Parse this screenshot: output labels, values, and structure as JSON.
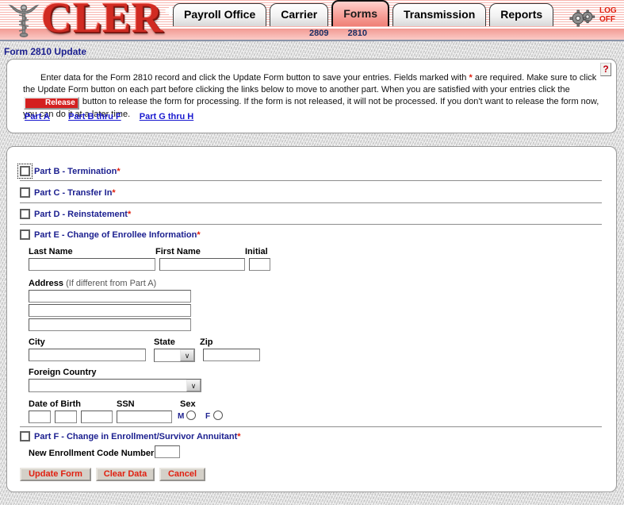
{
  "brand": {
    "name": "CLER",
    "logo_icon": "caduceus-icon"
  },
  "topnav": {
    "tabs": [
      {
        "label": "Payroll Office",
        "active": false
      },
      {
        "label": "Carrier",
        "active": false
      },
      {
        "label": "Forms",
        "active": true
      },
      {
        "label": "Transmission",
        "active": false
      },
      {
        "label": "Reports",
        "active": false
      }
    ],
    "subtabs": [
      {
        "label": "2809"
      },
      {
        "label": "2810"
      }
    ],
    "gears_icon": "gears-icon",
    "logoff_line1": "LOG",
    "logoff_line2": "OFF"
  },
  "page": {
    "title": "Form 2810 Update",
    "help_icon": "?"
  },
  "instructions": {
    "line1_a": "Enter data for the Form 2810 record and click the Update Form button to save your entries.  Fields marked with ",
    "asterisk": "*",
    "line1_b": " are required.  Make sure to click the Update Form button on each part before clicking the links below to move to another part.  When you are satisfied with your entries click the ",
    "release_label": "Release",
    "line1_c": " button to release the form for processing.  If the form is not released, it will not be processed.  If you don't want to release the form now, you can do it at a later time."
  },
  "part_links": [
    {
      "label": "Part A"
    },
    {
      "label": "Part B thru F"
    },
    {
      "label": "Part G thru H"
    }
  ],
  "parts": [
    {
      "id": "part-b",
      "label": "Part B - Termination",
      "required": "*",
      "checked": false,
      "focused": true
    },
    {
      "id": "part-c",
      "label": "Part C - Transfer In",
      "required": "*",
      "checked": false,
      "focused": false
    },
    {
      "id": "part-d",
      "label": "Part D - Reinstatement",
      "required": "*",
      "checked": false,
      "focused": false
    },
    {
      "id": "part-e",
      "label": "Part E - Change of Enrollee Information",
      "required": "*",
      "checked": false,
      "focused": false
    },
    {
      "id": "part-f",
      "label": "Part F - Change in Enrollment/Survivor Annuitant",
      "required": "*",
      "checked": false,
      "focused": false
    }
  ],
  "part_e": {
    "last_name_label": "Last Name",
    "last_name_value": "",
    "first_name_label": "First Name",
    "first_name_value": "",
    "initial_label": "Initial",
    "initial_value": "",
    "address_label": "Address",
    "address_note": "(If different from Part A)",
    "address_line1": "",
    "address_line2": "",
    "address_line3": "",
    "city_label": "City",
    "city_value": "",
    "state_label": "State",
    "state_value": "",
    "zip_label": "Zip",
    "zip_value": "",
    "foreign_country_label": "Foreign Country",
    "foreign_country_value": "",
    "dob_label": "Date of Birth",
    "dob_month": "",
    "dob_day": "",
    "dob_year": "",
    "ssn_label": "SSN",
    "ssn_value": "",
    "sex_label": "Sex",
    "sex_m_label": "M",
    "sex_f_label": "F",
    "sex_selected": ""
  },
  "part_f": {
    "code_label": "New Enrollment Code Number",
    "code_value": ""
  },
  "buttons": [
    {
      "label": "Update Form",
      "name": "update-form-button"
    },
    {
      "label": "Clear Data",
      "name": "clear-data-button"
    },
    {
      "label": "Cancel",
      "name": "cancel-button"
    }
  ],
  "colors": {
    "brand_red": "#d12b22",
    "link_blue": "#1a1ad0",
    "label_navy": "#1b1f8f",
    "required_red": "#e02010",
    "button_face": "#d4d0c8"
  }
}
